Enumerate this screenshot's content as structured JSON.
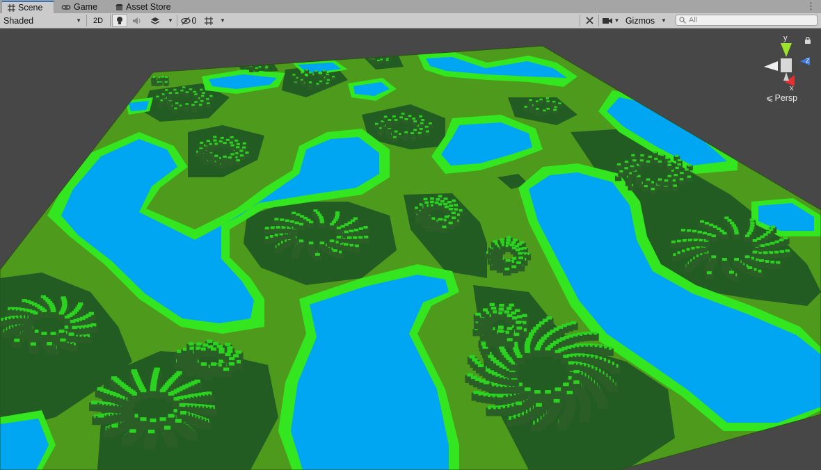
{
  "tabs": [
    {
      "label": "Scene",
      "icon": "grid-icon",
      "active": true
    },
    {
      "label": "Game",
      "icon": "gamepad-icon",
      "active": false
    },
    {
      "label": "Asset Store",
      "icon": "store-icon",
      "active": false
    }
  ],
  "toolbar": {
    "draw_mode": "Shaded",
    "mode_2d": "2D",
    "hidden_count": "0",
    "gizmos": "Gizmos",
    "search_placeholder": "All"
  },
  "scene_gizmo": {
    "axis_y": "y",
    "axis_z": "z",
    "axis_x": "x",
    "projection": "Persp"
  },
  "colors": {
    "water": "#00a6f2",
    "shore": "#33e61f",
    "grass": "#4d9a1c",
    "forest": "#235c23",
    "tree": "#2a5e26",
    "tree_highlight": "#2bd320",
    "background": "#474747"
  }
}
